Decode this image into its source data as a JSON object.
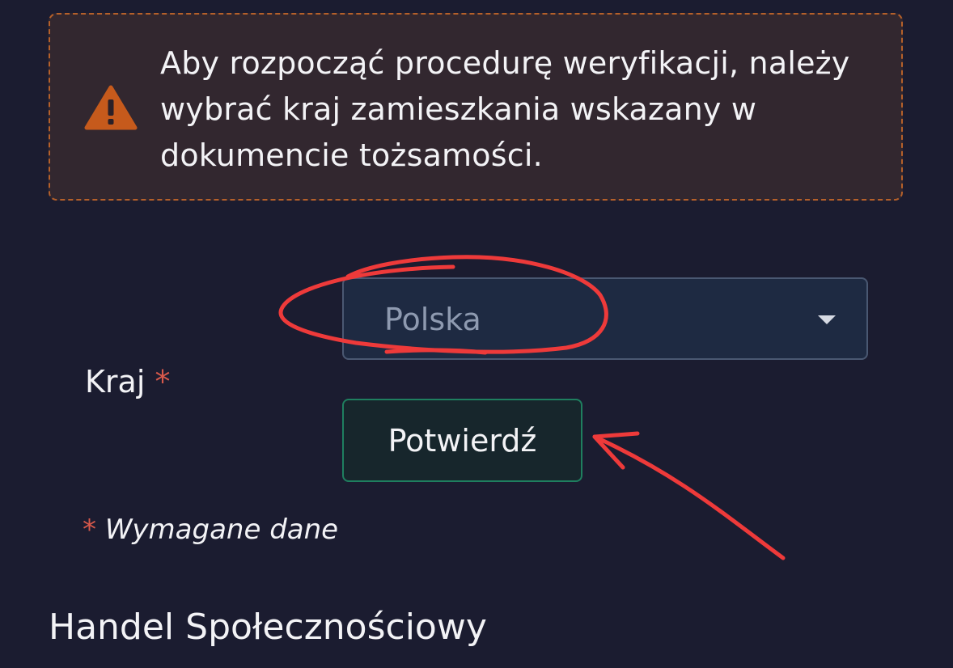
{
  "warning": {
    "icon": "warning-triangle-icon",
    "message": "Aby rozpocząć procedurę weryfikacji, należy wybrać kraj zamieszkania wskazany w dokumencie tożsamości."
  },
  "form": {
    "country_label": "Kraj",
    "required_mark": "*",
    "country_value": "Polska",
    "confirm_label": "Potwierdź",
    "required_note": "Wymagane dane"
  },
  "section": {
    "title": "Handel Społecznościowy"
  },
  "colors": {
    "background": "#1b1c30",
    "warning_border": "#b5602a",
    "warning_icon": "#c65a1c",
    "required_star": "#d8594b",
    "confirm_border": "#1f7f5f",
    "annotation": "#ee3a3a"
  },
  "annotations": {
    "circle_around": "country-select",
    "arrow_points_to": "confirm-button"
  }
}
